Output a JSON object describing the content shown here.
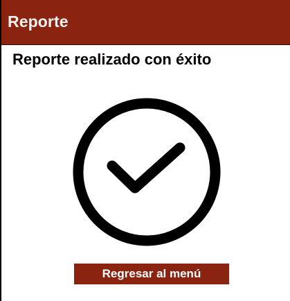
{
  "app_bar": {
    "title": "Reporte",
    "background_color": "#8a2410"
  },
  "main": {
    "heading": "Reporte realizado con éxito",
    "status_icon": "check-circle-icon"
  },
  "actions": {
    "back_to_menu_label": "Regresar al menú",
    "button_color": "#8a2410"
  }
}
